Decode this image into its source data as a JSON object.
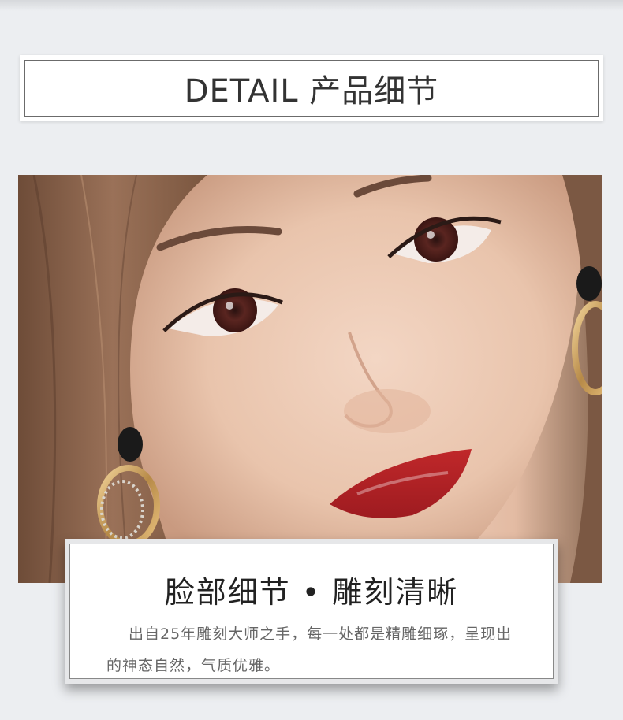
{
  "header": {
    "title": "DETAIL 产品细节"
  },
  "feature": {
    "title": "脸部细节 • 雕刻清晰",
    "description": "出自25年雕刻大师之手，每一处都是精雕细琢，呈现出的神态自然，气质优雅。"
  }
}
